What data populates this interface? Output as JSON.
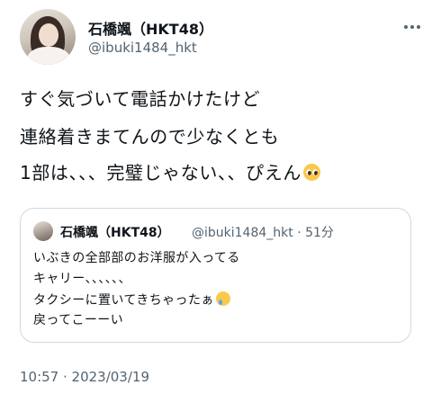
{
  "author": {
    "display_name": "石橋颯（HKT48）",
    "handle": "@ibuki1484_hkt"
  },
  "tweet": {
    "lines": [
      "すぐ気づいて電話かけたけど",
      "連絡着きまてんので少なくとも",
      "1部は、、、完璧じゃない、、ぴえん"
    ],
    "line3_emoji": "pleading-face-emoji"
  },
  "quoted_tweet": {
    "display_name": "石橋颯（HKT48）",
    "handle_time": "@ibuki1484_hkt · 51分",
    "lines": [
      "いぶきの全部部のお洋服が入ってる",
      "キャリー、、、、、、",
      "タクシーに置いてきちゃったぁ",
      "戻ってこーーい"
    ],
    "line3_emoji": "crying-face-emoji"
  },
  "timestamp": "10:57 · 2023/03/19"
}
